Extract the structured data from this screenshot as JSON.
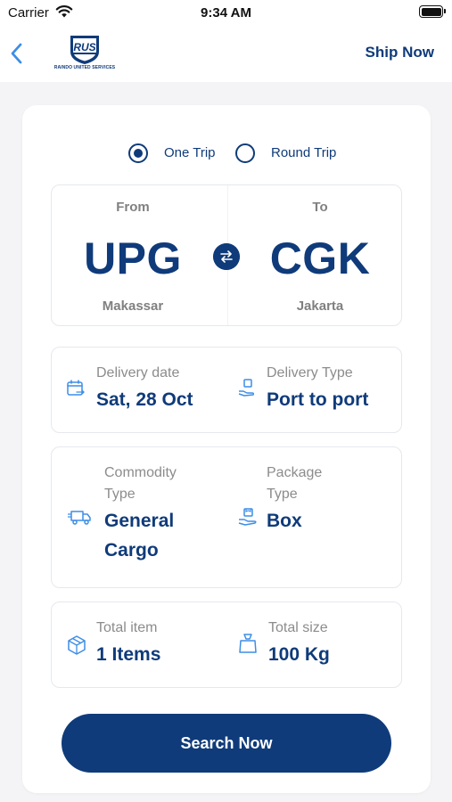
{
  "status_bar": {
    "carrier": "Carrier",
    "time": "9:34 AM"
  },
  "nav": {
    "logo_mark": "RUS",
    "logo_text": "RAINDO UNITED SERVICES",
    "action_label": "Ship Now"
  },
  "trip_type": {
    "options": [
      {
        "label": "One Trip",
        "selected": true
      },
      {
        "label": "Round Trip",
        "selected": false
      }
    ]
  },
  "route": {
    "from": {
      "caption": "From",
      "code": "UPG",
      "city": "Makassar"
    },
    "to": {
      "caption": "To",
      "code": "CGK",
      "city": "Jakarta"
    }
  },
  "delivery": {
    "date_label": "Delivery date",
    "date_value": "Sat, 28 Oct",
    "type_label": "Delivery Type",
    "type_value": "Port to port"
  },
  "commodity": {
    "commodity_label_1": "Commodity",
    "commodity_label_2": "Type",
    "commodity_value_1": "General",
    "commodity_value_2": "Cargo",
    "package_label_1": "Package",
    "package_label_2": "Type",
    "package_value": "Box"
  },
  "totals": {
    "item_label": "Total item",
    "item_value": "1 Items",
    "size_label": "Total size",
    "size_value": "100 Kg"
  },
  "search_button": {
    "label": "Search Now"
  },
  "icons": {
    "wifi": "wifi-icon",
    "battery": "battery-icon",
    "back": "chevron-left-icon",
    "swap": "swap-icon",
    "calendar": "calendar-icon",
    "delivery_type": "hand-box-icon",
    "commodity": "truck-icon",
    "package": "hand-package-icon",
    "item": "box-icon",
    "size": "weight-icon"
  },
  "colors": {
    "primary": "#0f3b7a",
    "accent_light": "#3d8ee6",
    "label_gray": "#8c8c8c",
    "background": "#f4f4f6"
  }
}
